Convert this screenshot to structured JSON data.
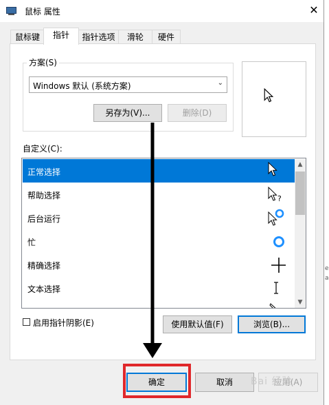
{
  "window": {
    "title": "鼠标 属性",
    "close_glyph": "✕"
  },
  "tabs": [
    {
      "label": "鼠标键"
    },
    {
      "label": "指针"
    },
    {
      "label": "指针选项"
    },
    {
      "label": "滑轮"
    },
    {
      "label": "硬件"
    }
  ],
  "scheme": {
    "group_label": "方案(S)",
    "selected": "Windows 默认 (系统方案)",
    "save_as_label": "另存为(V)...",
    "delete_label": "删除(D)"
  },
  "custom": {
    "label": "自定义(C):",
    "items": [
      {
        "label": "正常选择",
        "cursor": "arrow-icon"
      },
      {
        "label": "帮助选择",
        "cursor": "help-icon"
      },
      {
        "label": "后台运行",
        "cursor": "working-icon"
      },
      {
        "label": "忙",
        "cursor": "busy-icon"
      },
      {
        "label": "精确选择",
        "cursor": "crosshair-icon"
      },
      {
        "label": "文本选择",
        "cursor": "text-beam-icon"
      }
    ]
  },
  "shadow_checkbox": {
    "label": "启用指针阴影(E)",
    "checked": false
  },
  "buttons": {
    "use_default": "使用默认值(F)",
    "browse": "浏览(B)...",
    "ok": "确定",
    "cancel": "取消",
    "apply": "应用(A)"
  },
  "watermark": "Bai 经验",
  "edge_text": [
    "e",
    "a"
  ],
  "colors": {
    "selection": "#0078d7",
    "highlight_box": "#e0282b",
    "annotation_arrow": "#000000"
  }
}
